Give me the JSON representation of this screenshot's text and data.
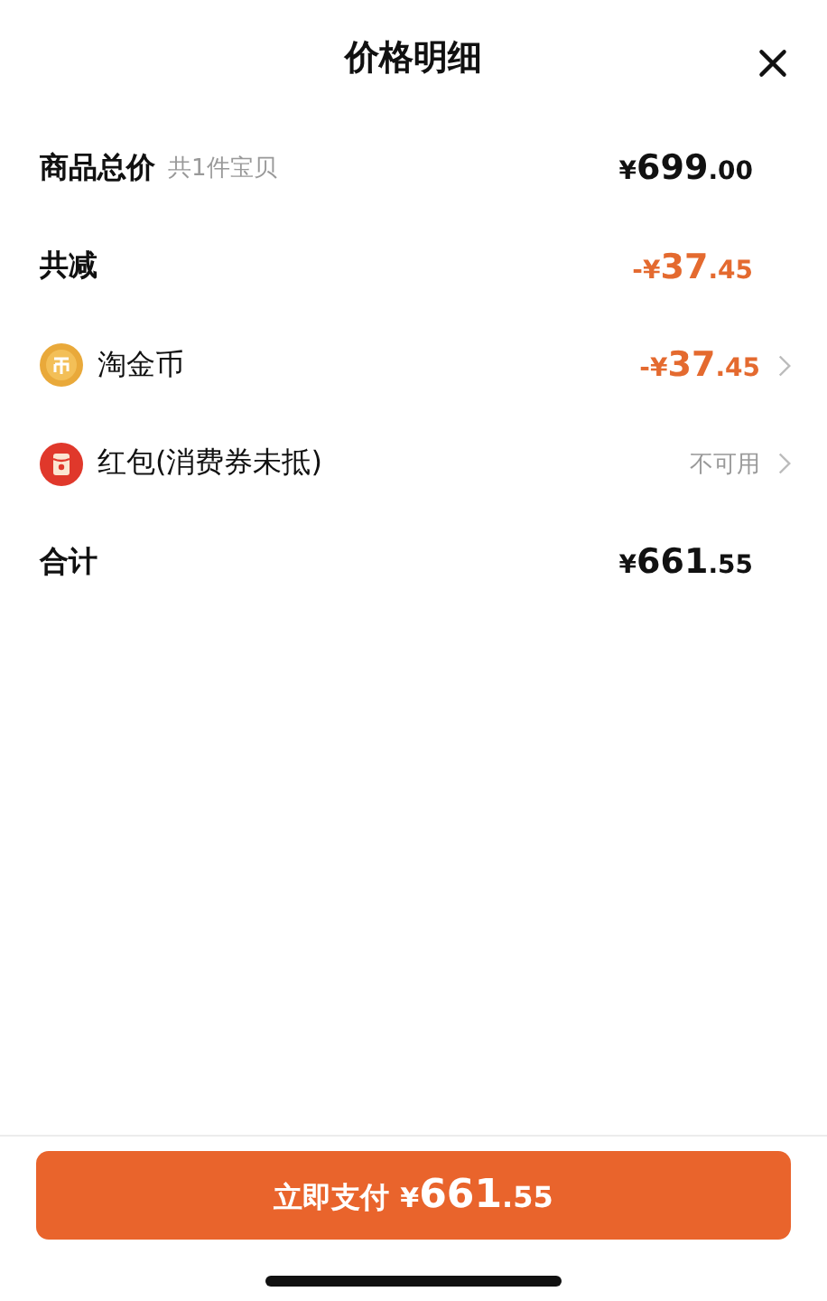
{
  "title": "价格明细",
  "rows": [
    {
      "kind": "subtotal",
      "label": "商品总价",
      "note": "共1件宝贝",
      "value": "¥699.00"
    },
    {
      "kind": "reduction",
      "label": "共减",
      "value": "-¥37.45"
    },
    {
      "kind": "coin",
      "label": "淘金币",
      "value": "-¥37.45"
    },
    {
      "kind": "envelope",
      "label": "红包(消费券未抵)",
      "value": "不可用"
    },
    {
      "kind": "total",
      "label": "合计",
      "value": "¥661.55"
    }
  ],
  "pay_button": {
    "label": "立即支付",
    "value": "¥661.55"
  }
}
